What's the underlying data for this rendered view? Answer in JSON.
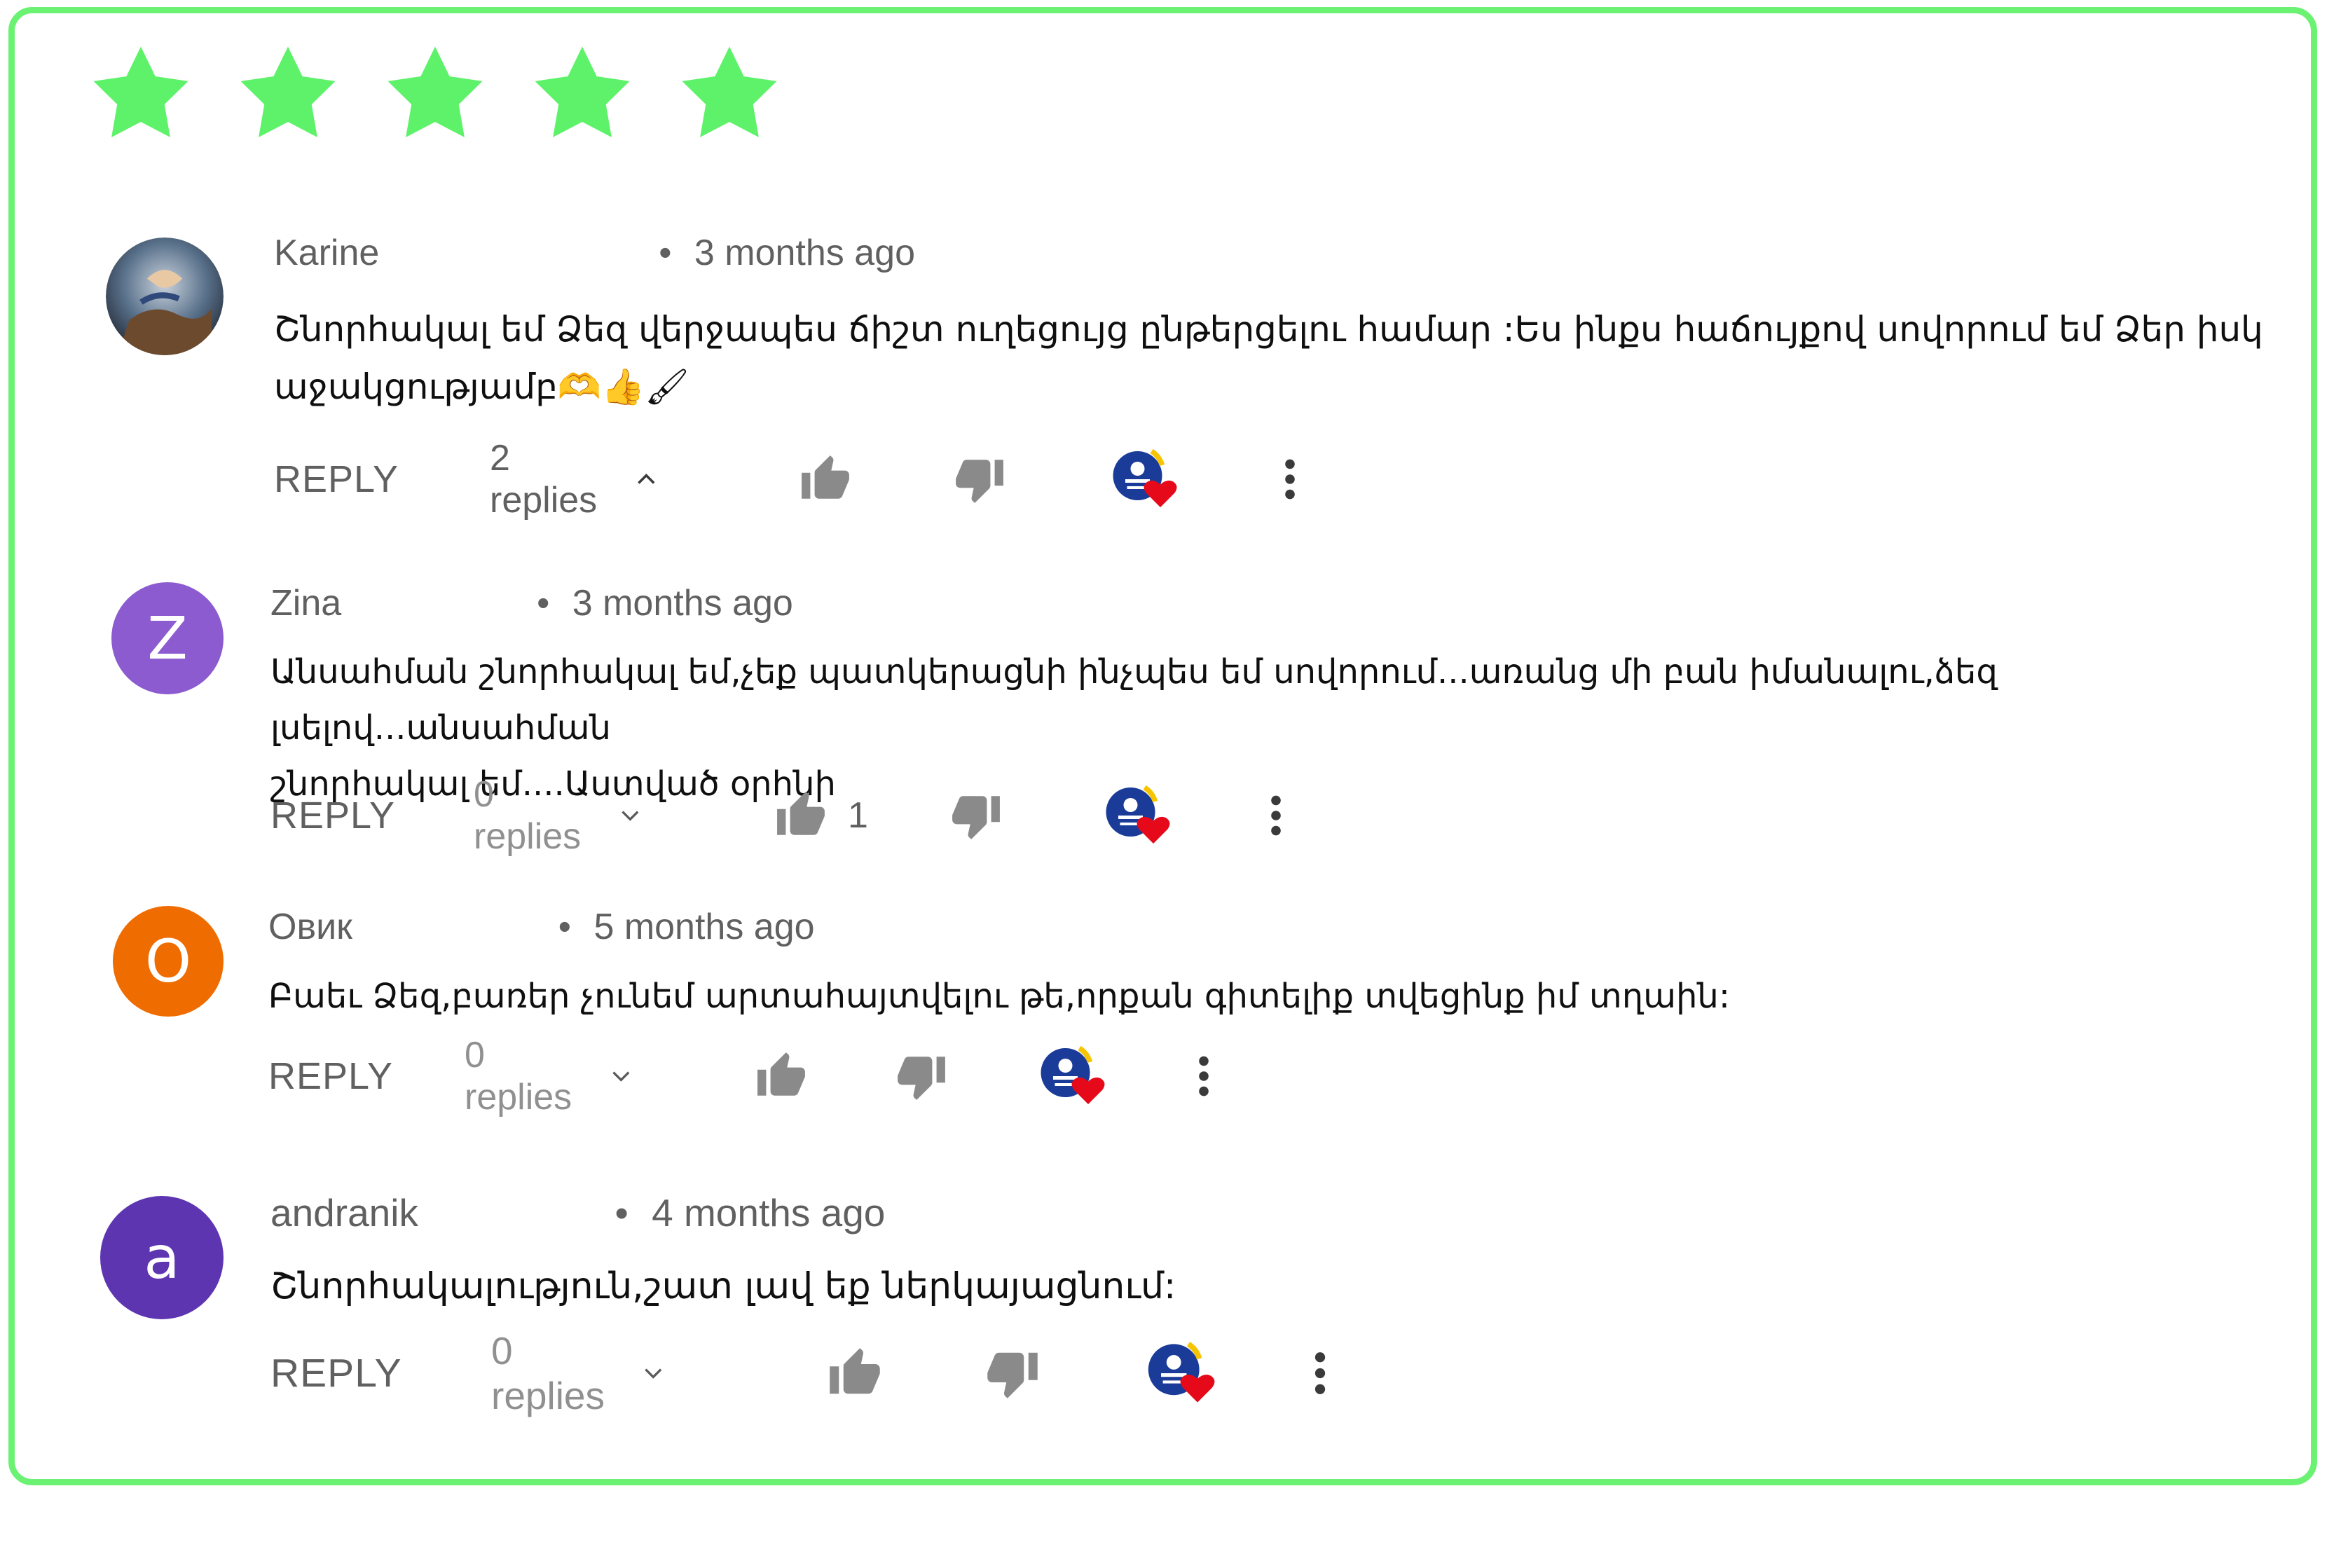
{
  "rating": {
    "stars": 5,
    "color": "#5ef26a"
  },
  "labels": {
    "reply": "REPLY"
  },
  "comments": [
    {
      "author": "Karine",
      "time": "3 months ago",
      "avatar": {
        "kind": "photo"
      },
      "text_lines": [
        "Շնորհակալ եմ Ձեզ վերջապես ճիշտ ուղեցույց ընթերցելու համար :Ես ինքս հաճույքով սովորում եմ  Ձեր իսկ",
        "աջակցությամբ"
      ],
      "emoji": "🫶👍🖌",
      "replies": "2 replies",
      "replies_expanded": true,
      "likes": ""
    },
    {
      "author": "Zina",
      "time": "3 months ago",
      "avatar": {
        "kind": "letter",
        "letter": "Z",
        "color": "#8c5bd0"
      },
      "text_lines": [
        "Անսահման շնորհակալ եմ,չեք պատկերացնի ինչպես եմ սովորում...առանց մի բան իմանալու,ձեզ լսելով...անսահման",
        "շնորհակալ եմ....Աստված օրհնի"
      ],
      "replies": "0 replies",
      "replies_expanded": false,
      "likes": "1"
    },
    {
      "author": "Овик",
      "time": "5 months ago",
      "avatar": {
        "kind": "letter",
        "letter": "О",
        "color": "#ef6c00"
      },
      "text_lines": [
        "Բաեւ Ձեզ,բառեր չունեմ արտահայտվելու թե,որքան գիտելիք տվեցինք իմ տղաին:"
      ],
      "replies": "0 replies",
      "replies_expanded": false,
      "likes": ""
    },
    {
      "author": "andranik",
      "time": "4 months ago",
      "avatar": {
        "kind": "letter",
        "letter": "a",
        "color": "#5e35b1"
      },
      "text_lines": [
        "Շնորհակալություն,շատ լավ եք ներկայացնում:"
      ],
      "replies": "0 replies",
      "replies_expanded": false,
      "likes": ""
    }
  ],
  "icons": {
    "like": "thumb-up-icon",
    "dislike": "thumb-down-icon",
    "creator_heart": "creator-heart-icon",
    "more": "more-vert-icon"
  },
  "colors": {
    "border": "#6cf273",
    "text": "#0f0f0f",
    "meta": "#606060",
    "heart": "#e5091a",
    "badge": "#1b3b99"
  }
}
